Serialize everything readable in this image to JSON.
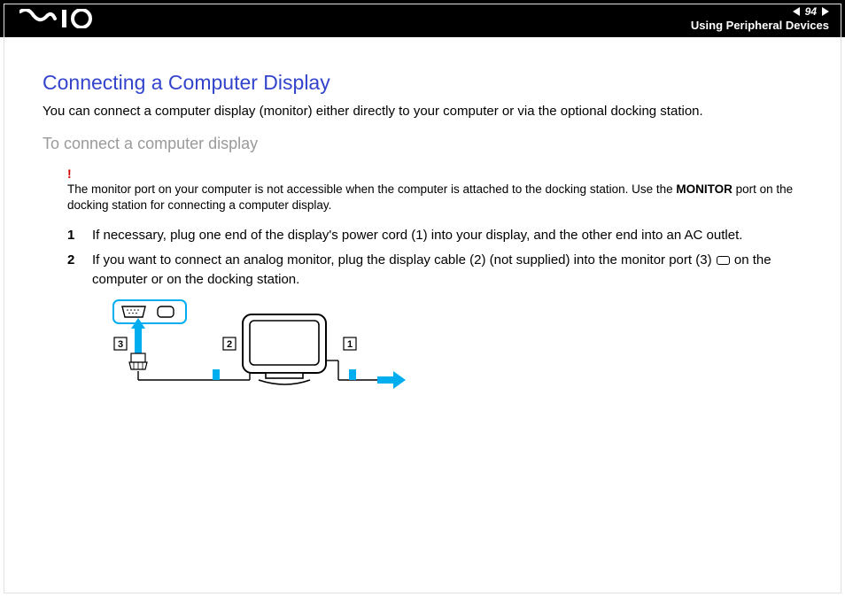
{
  "header": {
    "page_number": "94",
    "section": "Using Peripheral Devices"
  },
  "content": {
    "title": "Connecting a Computer Display",
    "intro": "You can connect a computer display (monitor) either directly to your computer or via the optional docking station.",
    "subtitle": "To connect a computer display",
    "note": {
      "pre": "The monitor port on your computer is not accessible when the computer is attached to the docking station. Use the ",
      "bold": "MONITOR",
      "post": " port on the docking station for connecting a computer display."
    },
    "steps": [
      {
        "n": "1",
        "text": "If necessary, plug one end of the display's power cord (1) into your display, and the other end into an AC outlet."
      },
      {
        "n": "2",
        "text_pre": "If you want to connect an analog monitor, plug the display cable (2) (not supplied) into the monitor port (3) ",
        "text_post": " on the computer or on the docking station."
      }
    ],
    "diagram_labels": {
      "l1": "1",
      "l2": "2",
      "l3": "3"
    }
  }
}
